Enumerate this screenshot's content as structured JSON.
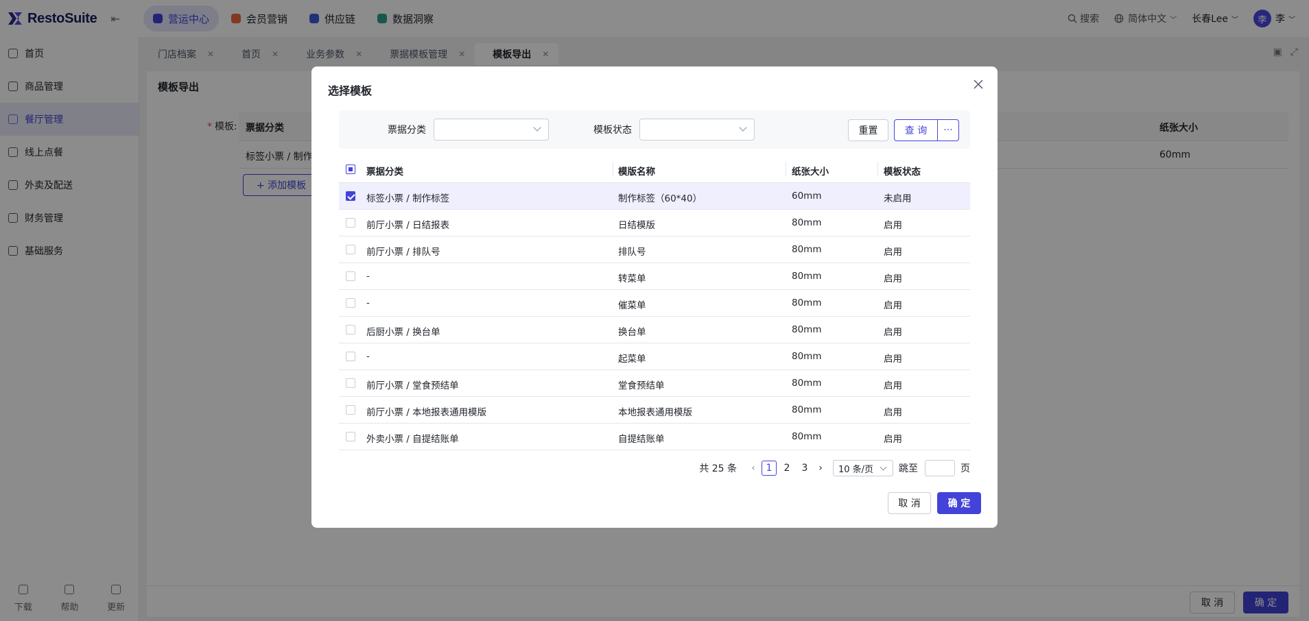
{
  "app": {
    "logo_text": "RestoSuite",
    "top_nav": [
      {
        "label": "营运中心",
        "active": true,
        "color": "#4343d9"
      },
      {
        "label": "会员营销",
        "active": false,
        "color": "#e86a3a"
      },
      {
        "label": "供应链",
        "active": false,
        "color": "#3b5bdb"
      },
      {
        "label": "数据洞察",
        "active": false,
        "color": "#2f9e8f"
      }
    ],
    "search_label": "搜索",
    "language_label": "简体中文",
    "store_label": "长春Lee",
    "avatar_initial": "李",
    "user_name": "李"
  },
  "sidebar": {
    "items": [
      {
        "label": "首页",
        "icon": "home-icon",
        "active": false
      },
      {
        "label": "商品管理",
        "icon": "box-icon",
        "active": false
      },
      {
        "label": "餐厅管理",
        "icon": "store-icon",
        "active": true
      },
      {
        "label": "线上点餐",
        "icon": "order-icon",
        "active": false
      },
      {
        "label": "外卖及配送",
        "icon": "bag-icon",
        "active": false
      },
      {
        "label": "财务管理",
        "icon": "folder-icon",
        "active": false
      },
      {
        "label": "基础服务",
        "icon": "grid-icon",
        "active": false
      }
    ],
    "bottom": [
      {
        "label": "下载",
        "icon": "download-icon"
      },
      {
        "label": "帮助",
        "icon": "help-icon"
      },
      {
        "label": "更新",
        "icon": "update-icon"
      }
    ]
  },
  "tabs": [
    {
      "label": "门店档案",
      "active": false
    },
    {
      "label": "首页",
      "active": false
    },
    {
      "label": "业务参数",
      "active": false
    },
    {
      "label": "票据模板管理",
      "active": false
    },
    {
      "label": "模板导出",
      "active": true
    }
  ],
  "page": {
    "title": "模板导出",
    "template_label": "模板:",
    "required_mark": "*",
    "bg_columns": [
      "票据分类",
      "纸张大小"
    ],
    "bg_row": {
      "category": "标签小票 / 制作",
      "paper": "60mm"
    },
    "add_button": "+ 添加模板",
    "footer_cancel": "取 消",
    "footer_ok": "确 定"
  },
  "modal": {
    "title": "选择模板",
    "filters": {
      "category_label": "票据分类",
      "status_label": "模板状态",
      "reset_label": "重置",
      "query_label": "查 询",
      "more_label": "···"
    },
    "columns": [
      "票据分类",
      "模版名称",
      "纸张大小",
      "模板状态"
    ],
    "rows": [
      {
        "category": "标签小票 / 制作标签",
        "name": "制作标签（60*40）",
        "paper": "60mm",
        "status": "未启用",
        "checked": true
      },
      {
        "category": "前厅小票 / 日结报表",
        "name": "日结模版",
        "paper": "80mm",
        "status": "启用",
        "checked": false
      },
      {
        "category": "前厅小票 / 排队号",
        "name": "排队号",
        "paper": "80mm",
        "status": "启用",
        "checked": false
      },
      {
        "category": "-",
        "name": "转菜单",
        "paper": "80mm",
        "status": "启用",
        "checked": false
      },
      {
        "category": "-",
        "name": "催菜单",
        "paper": "80mm",
        "status": "启用",
        "checked": false
      },
      {
        "category": "后厨小票 / 换台单",
        "name": "换台单",
        "paper": "80mm",
        "status": "启用",
        "checked": false
      },
      {
        "category": "-",
        "name": "起菜单",
        "paper": "80mm",
        "status": "启用",
        "checked": false
      },
      {
        "category": "前厅小票 / 堂食预结单",
        "name": "堂食预结单",
        "paper": "80mm",
        "status": "启用",
        "checked": false
      },
      {
        "category": "前厅小票 / 本地报表通用模版",
        "name": "本地报表通用模版",
        "paper": "80mm",
        "status": "启用",
        "checked": false
      },
      {
        "category": "外卖小票 / 自提结账单",
        "name": "自提结账单",
        "paper": "80mm",
        "status": "启用",
        "checked": false
      }
    ],
    "pagination": {
      "total_label": "共 25 条",
      "pages": [
        "1",
        "2",
        "3"
      ],
      "current_page": "1",
      "page_size_label": "10 条/页",
      "goto_label": "跳至",
      "goto_value": "",
      "page_unit": "页"
    },
    "cancel_label": "取 消",
    "ok_label": "确 定"
  },
  "colors": {
    "primary": "#4343d9",
    "mask": "rgba(0,0,0,0.45)"
  }
}
